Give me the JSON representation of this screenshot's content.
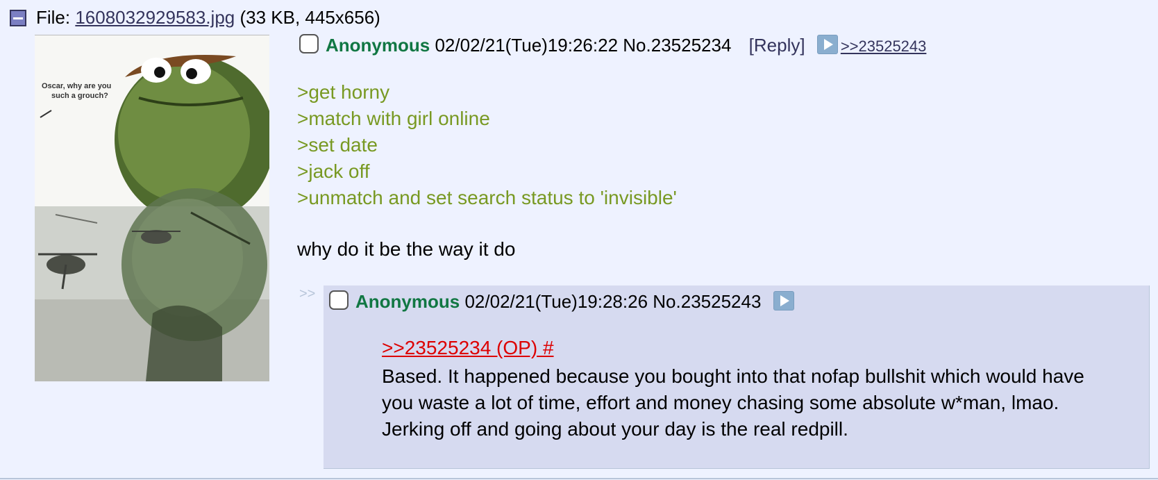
{
  "file": {
    "prefix": "File: ",
    "name": "1608032929583.jpg",
    "meta": " (33 KB, 445x656)"
  },
  "thumbnail": {
    "caption_line1": "Oscar, why are you",
    "caption_line2": "such a grouch?"
  },
  "op": {
    "name": "Anonymous",
    "datetime": "02/02/21(Tue)19:26:22",
    "post_no": "No.23525234",
    "reply_label": "[Reply]",
    "backlink": ">>23525243",
    "greentext": [
      ">get horny",
      ">match with girl online",
      ">set date",
      ">jack off",
      ">unmatch and set search status to 'invisible'"
    ],
    "closing": "why do it be the way it do"
  },
  "reply": {
    "arrows": ">>",
    "name": "Anonymous",
    "datetime": "02/02/21(Tue)19:28:26",
    "post_no": "No.23525243",
    "quote": ">>23525234 (OP) #",
    "text": "Based. It happened because you bought into that nofap bullshit which would have you waste a lot of time, effort and money chasing some absolute w*man, lmao. Jerking off and going about your day is the real redpill."
  },
  "colors": {
    "background": "#eef2ff",
    "name_green": "#117743",
    "greentext": "#789922",
    "quote_red": "#dd0000",
    "reply_bg": "#d6daf0"
  }
}
